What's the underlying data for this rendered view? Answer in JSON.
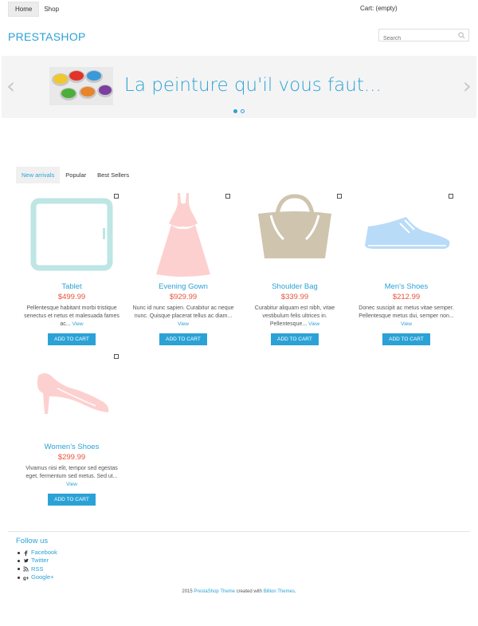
{
  "header": {
    "nav": [
      {
        "label": "Home"
      },
      {
        "label": "Shop"
      }
    ],
    "cart_label": "Cart: (empty)",
    "logo": "PRESTASHOP",
    "search_placeholder": "Search"
  },
  "slider": {
    "caption": "La peinture qu'il vous faut...",
    "prev_icon": "chevron-left-icon",
    "next_icon": "chevron-right-icon",
    "slide_count": 2,
    "active_slide": 1
  },
  "tabs": [
    {
      "label": "New arrivals",
      "active": true
    },
    {
      "label": "Popular",
      "active": false
    },
    {
      "label": "Best Sellers",
      "active": false
    }
  ],
  "products": [
    {
      "name": "Tablet",
      "price": "$499.99",
      "desc": "Pellentesque habitant morbi tristique senectus et netus et malesuada fames ac...",
      "view": "View",
      "cta": "ADD TO CART",
      "icon": "tablet-icon"
    },
    {
      "name": "Evening Gown",
      "price": "$929.99",
      "desc": "Nunc id nunc sapien. Curabitur ac neque nunc. Quisque placerat tellus ac diam...",
      "view": "View",
      "cta": "ADD TO CART",
      "icon": "dress-icon"
    },
    {
      "name": "Shoulder Bag",
      "price": "$339.99",
      "desc": "Curabitur aliquam est nibh, vitae vestibulum felis ultrices in. Pellentesque...",
      "view": "View",
      "cta": "ADD TO CART",
      "icon": "bag-icon"
    },
    {
      "name": "Men's Shoes",
      "price": "$212.99",
      "desc": "Donec suscipit ac metus vitae semper. Pellentesque metus dui, semper non...",
      "view": "View",
      "cta": "ADD TO CART",
      "icon": "shoe-icon"
    },
    {
      "name": "Women's Shoes",
      "price": "$299.99",
      "desc": "Vivamus nisi elit, tempor sed egestas eget, fermentum sed metus. Sed ut...",
      "view": "View",
      "cta": "ADD TO CART",
      "icon": "high-heel-icon"
    }
  ],
  "footer": {
    "follow_title": "Follow us",
    "social": [
      {
        "label": "Facebook",
        "icon": "facebook-icon"
      },
      {
        "label": "Twitter",
        "icon": "twitter-icon"
      },
      {
        "label": "RSS",
        "icon": "rss-icon"
      },
      {
        "label": "Google+",
        "icon": "google-plus-icon"
      }
    ],
    "copyright_prefix": "2015",
    "copyright_theme": "PrestaShop Theme",
    "copyright_mid": "created with",
    "copyright_author": "Billion Themes",
    "copyright_suffix": "."
  },
  "colors": {
    "accent": "#2ba2d6",
    "price": "#e7543b",
    "tablet": "#bde6e4",
    "dress": "#fdd0d0",
    "bag": "#cfc4ae",
    "mens_shoe": "#b8dbf8",
    "womens_shoe": "#fdd0d0"
  }
}
